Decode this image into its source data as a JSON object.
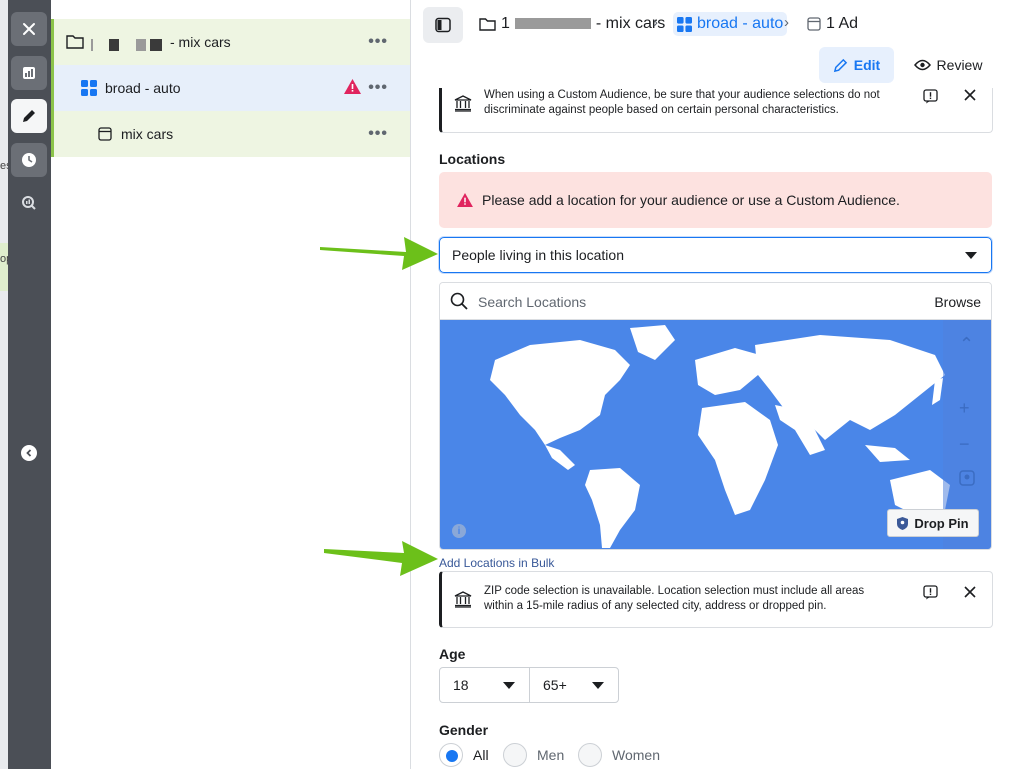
{
  "edge": {
    "peek_text_1": "es",
    "peek_text_2": "op"
  },
  "tree": {
    "campaign": {
      "label": "- mix cars",
      "more": "•••"
    },
    "adset": {
      "label": "broad - auto",
      "more": "•••"
    },
    "ad": {
      "label": "mix cars",
      "more": "•••"
    }
  },
  "breadcrumb": {
    "campaign_prefix": "1",
    "campaign_label": "- mix cars",
    "adset_label": "broad - auto",
    "ad_label": "1 Ad",
    "separator": "›"
  },
  "toolbar": {
    "edit_label": "Edit",
    "review_label": "Review"
  },
  "notice_top": {
    "text": "When using a Custom Audience, be sure that your audience selections do not discriminate against people based on certain personal characteristics."
  },
  "locations": {
    "label": "Locations",
    "error": "Please add a location for your audience or use a Custom Audience.",
    "selected_option": "People living in this location",
    "search_placeholder": "Search Locations",
    "browse_label": "Browse",
    "drop_pin_label": "Drop Pin",
    "bulk_link": "Add Locations in Bulk",
    "map_info": "i"
  },
  "notice_zip": {
    "text": "ZIP code selection is unavailable. Location selection must include all areas within a 15-mile radius of any selected city, address or dropped pin."
  },
  "age": {
    "label": "Age",
    "min": "18",
    "max": "65+"
  },
  "gender": {
    "label": "Gender",
    "options": [
      "All",
      "Men",
      "Women"
    ],
    "selected": "All"
  },
  "colors": {
    "accent": "#1877f2",
    "error_bg": "#fde2e0",
    "rail": "#4b4f56",
    "annotation_arrow": "#6cc01a",
    "map_water": "#4a86e8"
  }
}
